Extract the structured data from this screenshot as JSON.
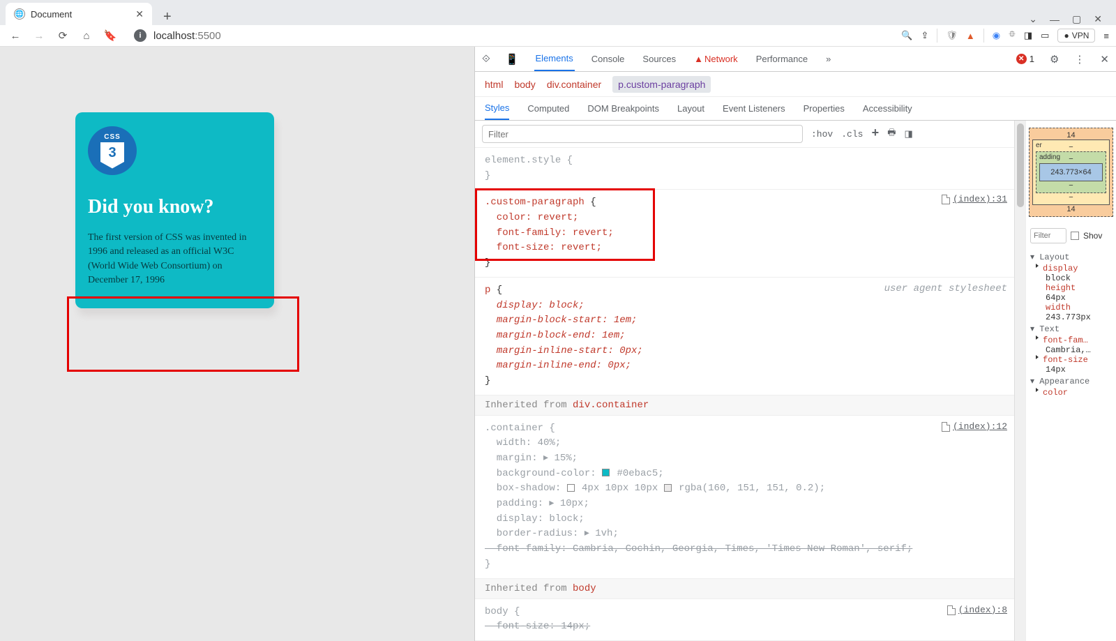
{
  "browser": {
    "tab_title": "Document",
    "url_prefix": "localhost",
    "url_suffix": ":5500",
    "vpn": "VPN"
  },
  "card": {
    "logo_text": "CSS",
    "heading": "Did you know?",
    "paragraph": "The first version of CSS was invented in 1996 and released as an official W3C (World Wide Web Consortium) on December 17, 1996"
  },
  "devtools": {
    "tabs": {
      "elements": "Elements",
      "console": "Console",
      "sources": "Sources",
      "network": "Network",
      "performance": "Performance",
      "more": "»"
    },
    "errors": "1",
    "breadcrumb": {
      "html": "html",
      "body": "body",
      "container": "div.container",
      "selected": "p.custom-paragraph"
    },
    "panel_tabs": {
      "styles": "Styles",
      "computed": "Computed",
      "dom_breakpoints": "DOM Breakpoints",
      "layout": "Layout",
      "event_listeners": "Event Listeners",
      "properties": "Properties",
      "accessibility": "Accessibility"
    },
    "filter_placeholder": "Filter",
    "hov": ":hov",
    "cls": ".cls",
    "rules": {
      "element_style": "element.style {\n}",
      "custom_paragraph_sel": ".custom-paragraph",
      "custom_paragraph_body": "  color: revert;\n  font-family: revert;\n  font-size: revert;",
      "custom_paragraph_link": "(index):31",
      "p_sel": "p",
      "p_body_l1": "  display: block;",
      "p_body_l2": "  margin-block-start: 1em;",
      "p_body_l3": "  margin-block-end: 1em;",
      "p_body_l4": "  margin-inline-start: 0px;",
      "p_body_l5": "  margin-inline-end: 0px;",
      "p_ua": "user agent stylesheet",
      "inherit_container": "Inherited from ",
      "inherit_container_sel": "div.container",
      "container_sel": ".container",
      "container_link": "(index):12",
      "container_l1": "  width: 40%;",
      "container_l2": "  margin: ▸ 15%;",
      "container_l3a": "  background-color: ",
      "container_l3b": "#0ebac5;",
      "container_l4a": "  box-shadow: ",
      "container_l4b": "4px 10px 10px ",
      "container_l4c": "rgba(160, 151, 151, 0.2);",
      "container_l5": "  padding: ▸ 10px;",
      "container_l6": "  display: block;",
      "container_l7": "  border-radius: ▸ 1vh;",
      "container_l8": "  font-family: Cambria, Cochin, Georgia, Times, 'Times New Roman', serif;",
      "inherit_body": "Inherited from ",
      "inherit_body_sel": "body",
      "body_sel": "body",
      "body_link": "(index):8",
      "body_l1": "  font-size: 14px;"
    },
    "box_model": {
      "margin_top": "14",
      "margin_bottom": "14",
      "border": "−",
      "padding_label": "adding",
      "padding": "−",
      "content": "243.773×64"
    },
    "computed": {
      "filter": "Filter",
      "show": "Shov",
      "layout": "Layout",
      "display": "display",
      "display_val": "block",
      "height": "height",
      "height_val": "64px",
      "width": "width",
      "width_val": "243.773px",
      "text": "Text",
      "font_family": "font-fam…",
      "font_family_val": "Cambria,…",
      "font_size": "font-size",
      "font_size_val": "14px",
      "appearance": "Appearance",
      "color": "color"
    }
  }
}
